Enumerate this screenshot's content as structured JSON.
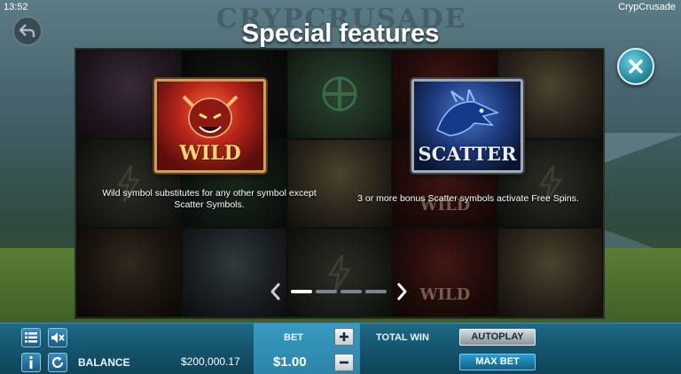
{
  "status_bar": {
    "time": "13:52",
    "app_name": "CrypCrusade"
  },
  "game_logo": "CRYPCRUSADE",
  "page_title": "Special features",
  "symbols": {
    "wild": {
      "label": "WILD",
      "description": "Wild symbol substitutes for any other symbol except Scatter Symbols."
    },
    "scatter": {
      "label": "SCATTER",
      "description": "3 or more bonus Scatter symbols activate Free Spins."
    }
  },
  "background_reel_words": [
    "WILD",
    "WILD"
  ],
  "pager": {
    "page_count": 4,
    "active_index": 0
  },
  "bottom_bar": {
    "balance_label": "BALANCE",
    "balance_value": "$200,000.17",
    "bet_label": "BET",
    "bet_value": "$1.00",
    "total_win_label": "TOTAL WIN",
    "autoplay_label": "AUTOPLAY",
    "max_bet_label": "MAX BET"
  },
  "icons": {
    "back": "back-arrow-icon",
    "close": "close-icon",
    "menu": "menu-icon",
    "sound": "sound-muted-icon",
    "info": "info-icon",
    "history": "refresh-icon",
    "prev": "chevron-left-icon",
    "next": "chevron-right-icon"
  },
  "colors": {
    "bar": "#16566e",
    "accent": "#2a8aa0",
    "wild_gold": "#f6d27a",
    "scatter_blue": "#1f3c82"
  }
}
